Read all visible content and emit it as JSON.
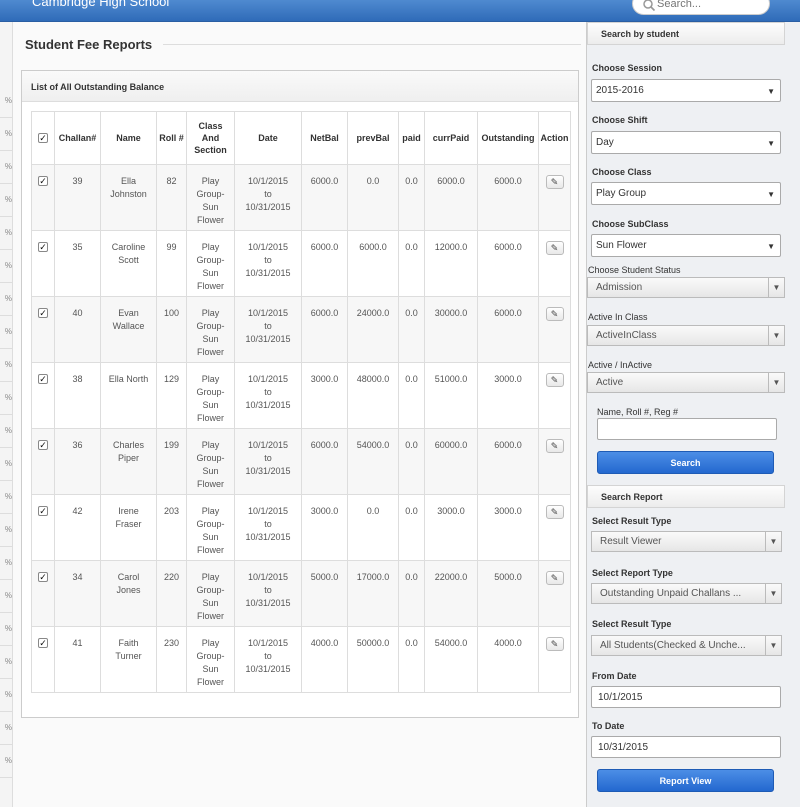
{
  "header": {
    "app_title": "Cambridge High School",
    "search_placeholder": "Search..."
  },
  "left_strip": {
    "marks": [
      "%",
      "%",
      "%",
      "%",
      "%",
      "%",
      "%",
      "%",
      "%",
      "%",
      "%",
      "%",
      "%",
      "%",
      "%",
      "%",
      "%",
      "%",
      "%",
      "%",
      "%"
    ]
  },
  "main": {
    "page_title": "Student Fee Reports",
    "panel_title": "List of All Outstanding Balance",
    "table": {
      "headers": {
        "challan": "Challan#",
        "name": "Name",
        "roll": "Roll #",
        "class_section": "Class And Section",
        "date": "Date",
        "netbal": "NetBal",
        "prevbal": "prevBal",
        "paid": "paid",
        "currpaid": "currPaid",
        "outstanding": "Outstanding",
        "action": "Action"
      },
      "rows": [
        {
          "challan": "39",
          "name": "Ella Johnston",
          "roll": "82",
          "class_section": "Play Group-Sun Flower",
          "date": "10/1/2015 to 10/31/2015",
          "netbal": "6000.0",
          "prevbal": "0.0",
          "paid": "0.0",
          "currpaid": "6000.0",
          "outstanding": "6000.0"
        },
        {
          "challan": "35",
          "name": "Caroline Scott",
          "roll": "99",
          "class_section": "Play Group-Sun Flower",
          "date": "10/1/2015 to 10/31/2015",
          "netbal": "6000.0",
          "prevbal": "6000.0",
          "paid": "0.0",
          "currpaid": "12000.0",
          "outstanding": "6000.0"
        },
        {
          "challan": "40",
          "name": "Evan Wallace",
          "roll": "100",
          "class_section": "Play Group-Sun Flower",
          "date": "10/1/2015 to 10/31/2015",
          "netbal": "6000.0",
          "prevbal": "24000.0",
          "paid": "0.0",
          "currpaid": "30000.0",
          "outstanding": "6000.0"
        },
        {
          "challan": "38",
          "name": "Ella North",
          "roll": "129",
          "class_section": "Play Group-Sun Flower",
          "date": "10/1/2015 to 10/31/2015",
          "netbal": "3000.0",
          "prevbal": "48000.0",
          "paid": "0.0",
          "currpaid": "51000.0",
          "outstanding": "3000.0"
        },
        {
          "challan": "36",
          "name": "Charles Piper",
          "roll": "199",
          "class_section": "Play Group-Sun Flower",
          "date": "10/1/2015 to 10/31/2015",
          "netbal": "6000.0",
          "prevbal": "54000.0",
          "paid": "0.0",
          "currpaid": "60000.0",
          "outstanding": "6000.0"
        },
        {
          "challan": "42",
          "name": "Irene Fraser",
          "roll": "203",
          "class_section": "Play Group-Sun Flower",
          "date": "10/1/2015 to 10/31/2015",
          "netbal": "3000.0",
          "prevbal": "0.0",
          "paid": "0.0",
          "currpaid": "3000.0",
          "outstanding": "3000.0"
        },
        {
          "challan": "34",
          "name": "Carol Jones",
          "roll": "220",
          "class_section": "Play Group-Sun Flower",
          "date": "10/1/2015 to 10/31/2015",
          "netbal": "5000.0",
          "prevbal": "17000.0",
          "paid": "0.0",
          "currpaid": "22000.0",
          "outstanding": "5000.0"
        },
        {
          "challan": "41",
          "name": "Faith Turner",
          "roll": "230",
          "class_section": "Play Group-Sun Flower",
          "date": "10/1/2015 to 10/31/2015",
          "netbal": "4000.0",
          "prevbal": "50000.0",
          "paid": "0.0",
          "currpaid": "54000.0",
          "outstanding": "4000.0"
        }
      ]
    }
  },
  "sidebar": {
    "search_by_student": {
      "heading": "Search by student",
      "session_label": "Choose Session",
      "session_value": "2015-2016",
      "shift_label": "Choose Shift",
      "shift_value": "Day",
      "class_label": "Choose Class",
      "class_value": "Play Group",
      "subclass_label": "Choose SubClass",
      "subclass_value": "Sun Flower",
      "status_label": "Choose Student Status",
      "status_value": "Admission",
      "active_in_class_label": "Active In Class",
      "active_in_class_value": "ActiveInClass",
      "active_inactive_label": "Active / InActive",
      "active_inactive_value": "Active",
      "name_search_label": "Name, Roll #, Reg #",
      "name_search_value": "",
      "search_button": "Search"
    },
    "search_report": {
      "heading": "Search Report",
      "result_type_label": "Select Result Type",
      "result_type_value": "Result Viewer",
      "report_type_label": "Select Report Type",
      "report_type_value": "Outstanding Unpaid Challans ...",
      "result_type2_label": "Select Result Type",
      "result_type2_value": "All Students(Checked & Unche...",
      "from_date_label": "From Date",
      "from_date_value": "10/1/2015",
      "to_date_label": "To Date",
      "to_date_value": "10/31/2015",
      "report_button": "Report View"
    }
  }
}
